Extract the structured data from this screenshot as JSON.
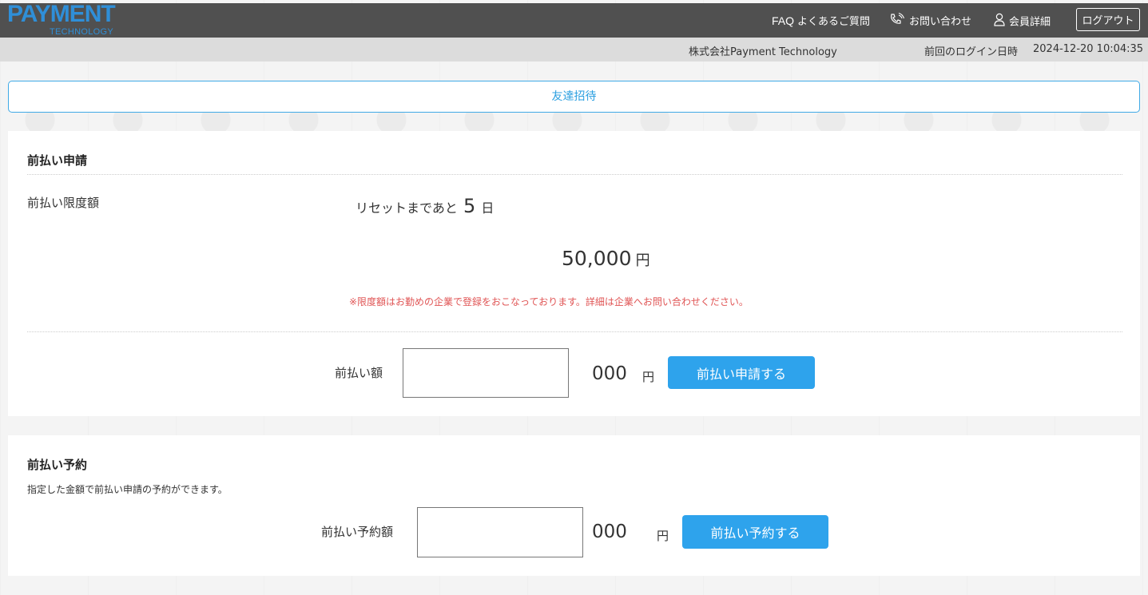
{
  "header": {
    "logo_main": "PAYMENT",
    "logo_sub": "TECHNOLOGY",
    "nav": {
      "faq_prefix": "FAQ",
      "faq_label": "よくあるご質問",
      "contact_label": "お問い合わせ",
      "member_label": "会員詳細",
      "logout_label": "ログアウト"
    }
  },
  "subheader": {
    "company": "株式会社Payment Technology",
    "last_login_label": "前回のログイン日時",
    "last_login_value": "2024-12-20 10:04:35"
  },
  "invite": {
    "label": "友達招待"
  },
  "prepay_apply": {
    "title": "前払い申請",
    "limit_label": "前払い限度額",
    "reset_prefix": "リセットまであと",
    "reset_days": "5",
    "reset_unit": "日",
    "limit_amount": "50,000",
    "limit_unit": "円",
    "notice": "※限度額はお勤めの企業で登録をおこなっております。詳細は企業へお問い合わせください。",
    "amount_label": "前払い額",
    "amount_value": "",
    "amount_suffix": "000",
    "amount_unit": "円",
    "submit_label": "前払い申請する"
  },
  "prepay_reserve": {
    "title": "前払い予約",
    "description": "指定した金額で前払い申請の予約ができます。",
    "amount_label": "前払い予約額",
    "amount_value": "",
    "amount_suffix": "000",
    "amount_unit": "円",
    "submit_label": "前払い予約する"
  },
  "colors": {
    "header_bg": "#505050",
    "subheader_bg": "#dcdcdc",
    "accent": "#2ea3ec",
    "logo": "#2f8fd8",
    "notice": "#e05555"
  }
}
